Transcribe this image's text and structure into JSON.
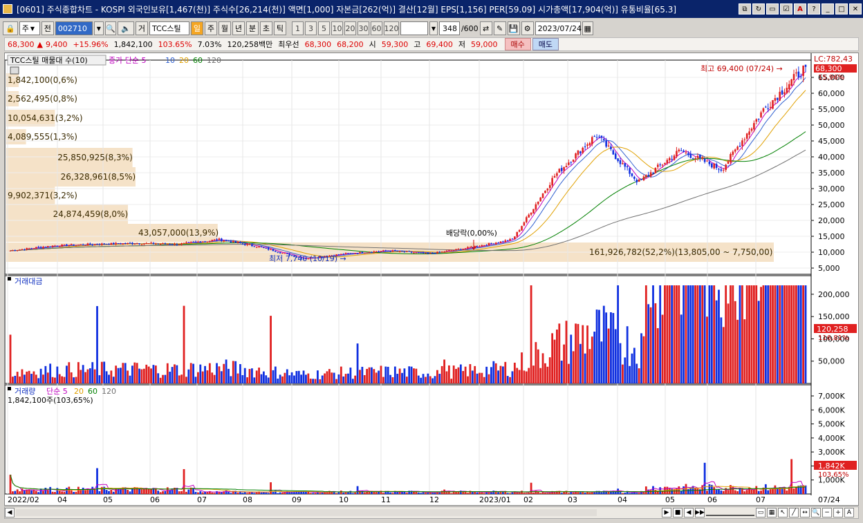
{
  "window": {
    "title": "[0601] 주식종합차트 - KOSPI 외국인보유[1,467(천)] 주식수[26,214(천)] 액면[1,000] 자본금[262(억)] 결산[12월] EPS[1,156] PER[59.09] 시가총액[17,904(억)] 유통비율[65.3]",
    "controls": [
      "⧉",
      "↻",
      "▭",
      "☑",
      "A",
      "?",
      "_",
      "□",
      "✕"
    ]
  },
  "toolbar": {
    "mode_select": "주",
    "prev_label": "전",
    "stock_code": "002710",
    "type_label": "거",
    "stock_name": "TCC스틸",
    "periods": [
      "일",
      "주",
      "월",
      "년",
      "분",
      "초",
      "틱"
    ],
    "active_period": "일",
    "intervals": [
      "1",
      "3",
      "5",
      "10",
      "20",
      "30",
      "60",
      "120"
    ],
    "count_value": "348",
    "count_total": "/600",
    "date_value": "2023/07/24"
  },
  "quote": {
    "price": "68,300",
    "change": "9,400",
    "change_pct": "+15.96%",
    "volume": "1,842,100",
    "vol_ratio": "103.65%",
    "turnover": "7.03%",
    "amount": "120,258백만",
    "best_label": "최우선",
    "best_ask": "68,300",
    "best_bid": "68,200",
    "open_label": "시",
    "open": "59,300",
    "high_label": "고",
    "high": "69,400",
    "low_label": "저",
    "low": "59,000",
    "buy_label": "매수",
    "sell_label": "매도"
  },
  "legend": {
    "price_title": "TCC스틸 매물대 수(10)",
    "ma_label": "종가 단순 5",
    "ma_periods": [
      "10",
      "20",
      "60",
      "120"
    ],
    "ma_colors": [
      "#c000c0",
      "#3060d0",
      "#e0a000",
      "#008000",
      "#707070"
    ],
    "amount_title": "거래대금",
    "volume_title": "거래량",
    "volume_ma_label": "단순 5",
    "volume_ma_periods": [
      "20",
      "60",
      "120"
    ],
    "volume_current": "1,842,100주(103,65%)"
  },
  "annotations": {
    "high": "최고 69,400 (07/24) →",
    "low": "최저 7,740 (10/19) →",
    "dividend": "배당락(0,00%)",
    "lc": "LC:782,43",
    "price_tag": "68,300",
    "price_tag_pct": "15,96%",
    "amount_tag": "120,258",
    "amount_tag_pct": "116,81%",
    "volume_tag": "1,842K",
    "volume_tag_pct": "103,65%"
  },
  "colors": {
    "up": "#e02020",
    "down": "#1030e0",
    "band": "#f5e2c8",
    "tag": "#e02020"
  },
  "chart_data": {
    "type": "candlestick",
    "title": "TCC스틸",
    "x_ticks": [
      "2022/02",
      "04",
      "05",
      "06",
      "07",
      "08",
      "09",
      "10",
      "11",
      "12",
      "2023/01",
      "02",
      "03",
      "04",
      "05",
      "06",
      "07",
      "07/24"
    ],
    "price_axis": [
      "5,000",
      "10,000",
      "15,000",
      "20,000",
      "25,000",
      "30,000",
      "35,000",
      "40,000",
      "45,000",
      "50,000",
      "55,000",
      "60,000",
      "65,000"
    ],
    "amount_axis": [
      "50,000",
      "100,000",
      "150,000",
      "200,000"
    ],
    "volume_axis": [
      "1,000K",
      "2,000K",
      "3,000K",
      "4,000K",
      "5,000K",
      "6,000K",
      "7,000K"
    ],
    "volume_profile": [
      {
        "label": "1,842,100(0,6%)",
        "pct": 0.6
      },
      {
        "label": "2,562,495(0,8%)",
        "pct": 0.8
      },
      {
        "label": "10,054,631(3,2%)",
        "pct": 3.2
      },
      {
        "label": "4,089,555(1,3%)",
        "pct": 1.3
      },
      {
        "label": "25,850,925(8,3%)",
        "pct": 8.3
      },
      {
        "label": "26,328,961(8,5%)",
        "pct": 8.5
      },
      {
        "label": "9,902,371(3,2%)",
        "pct": 3.2
      },
      {
        "label": "24,874,459(8,0%)",
        "pct": 8.0
      },
      {
        "label": "43,057,000(13,9%)",
        "pct": 13.9
      },
      {
        "label": "161,926,782(52,2%)(13,805,00 ~ 7,750,00)",
        "pct": 52.2
      }
    ],
    "close_trend": [
      {
        "x": "2022/02",
        "y": 10500
      },
      {
        "x": "04",
        "y": 12000
      },
      {
        "x": "05",
        "y": 12500
      },
      {
        "x": "06",
        "y": 12800
      },
      {
        "x": "07",
        "y": 12500
      },
      {
        "x": "08",
        "y": 14000
      },
      {
        "x": "09",
        "y": 11500
      },
      {
        "x": "10",
        "y": 8000
      },
      {
        "x": "11",
        "y": 9500
      },
      {
        "x": "12",
        "y": 10500
      },
      {
        "x": "2023/01",
        "y": 9500
      },
      {
        "x": "02",
        "y": 11500
      },
      {
        "x": "03",
        "y": 14000
      },
      {
        "x": "04",
        "y": 34000
      },
      {
        "x": "04",
        "y": 47000
      },
      {
        "x": "05",
        "y": 32000
      },
      {
        "x": "06",
        "y": 42000
      },
      {
        "x": "06",
        "y": 36000
      },
      {
        "x": "07",
        "y": 55000
      },
      {
        "x": "07/24",
        "y": 68300
      }
    ],
    "ylim": [
      5000,
      69400
    ]
  }
}
